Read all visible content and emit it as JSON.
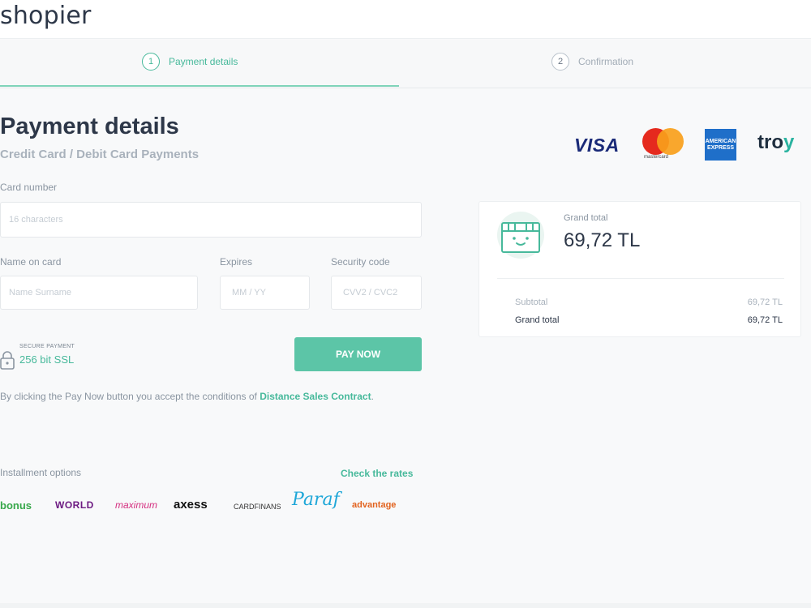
{
  "header": {
    "logo": "shopier"
  },
  "steps": [
    {
      "number": "1",
      "label": "Payment details",
      "state": "active"
    },
    {
      "number": "2",
      "label": "Confirmation",
      "state": "inactive"
    }
  ],
  "page": {
    "title": "Payment details",
    "subtitle": "Credit Card / Debit Card Payments"
  },
  "card_brands": {
    "visa": "VISA",
    "mastercard": "mastercard",
    "amex": "AMERICAN EXPRESS",
    "troy_main": "tro",
    "troy_accent": "y"
  },
  "form": {
    "card_number": {
      "label": "Card number",
      "placeholder": "16 characters"
    },
    "name_on_card": {
      "label": "Name on card",
      "placeholder": "Name Surname"
    },
    "expires": {
      "label": "Expires",
      "placeholder": "MM / YY"
    },
    "security_code": {
      "label": "Security code",
      "placeholder": "CVV2 / CVC2"
    }
  },
  "secure": {
    "small": "SECURE PAYMENT",
    "big": "256 bit SSL"
  },
  "pay_button": "PAY NOW",
  "terms": {
    "prefix": "By clicking the Pay Now button you accept the conditions of ",
    "link": "Distance Sales Contract",
    "suffix": "."
  },
  "installments": {
    "label": "Installment options",
    "rates_link": "Check the rates",
    "banks": [
      "bonus",
      "WORLD",
      "maximum",
      "axess",
      "CARDFINANS",
      "Paraf",
      "advantage"
    ]
  },
  "summary": {
    "grand_total_label": "Grand total",
    "grand_total_value": "69,72 TL",
    "rows": [
      {
        "label": "Subtotal",
        "value": "69,72 TL"
      },
      {
        "label": "Grand total",
        "value": "69,72 TL"
      }
    ]
  },
  "colors": {
    "accent": "#47b99b",
    "button": "#5cc5a7",
    "text": "#2d3748",
    "muted": "#8a95a1"
  },
  "icons": {
    "step_indicator": "circle-number-icon",
    "lock": "lock-icon",
    "basket": "basket-smile-icon"
  }
}
